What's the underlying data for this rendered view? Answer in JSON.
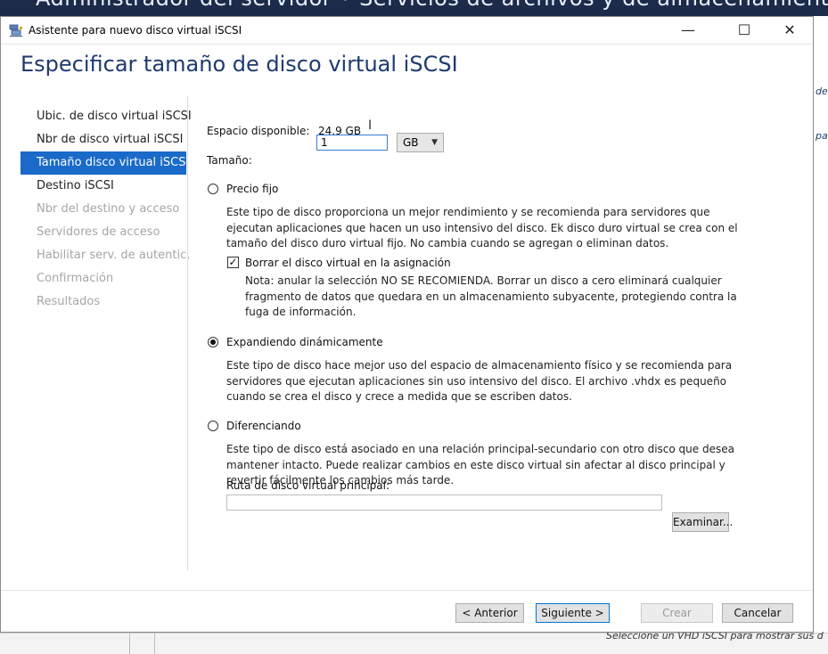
{
  "background": {
    "top_text": "Administrador del servidor • Servicios de archivos y de almacenamiento • iSCSI",
    "right_frag_1": "de",
    "right_frag_2": "par",
    "bottom_frag": "Seleccione un VHD iSCSI para mostrar sus d"
  },
  "window": {
    "title": "Asistente para nuevo disco virtual iSCSI",
    "minimize": "—",
    "maximize": "☐",
    "close": "✕"
  },
  "page_title": "Especificar tamaño de disco virtual iSCSI",
  "nav": {
    "items": [
      {
        "label": "Ubic. de disco virtual iSCSI",
        "state": "normal"
      },
      {
        "label": "Nbr de disco virtual iSCSI",
        "state": "normal"
      },
      {
        "label": "Tamaño disco virtual iSCSI",
        "state": "selected"
      },
      {
        "label": "Destino iSCSI",
        "state": "normal"
      },
      {
        "label": "Nbr del destino y acceso",
        "state": "disabled"
      },
      {
        "label": "Servidores de acceso",
        "state": "disabled"
      },
      {
        "label": "Habilitar serv. de autentic.",
        "state": "disabled"
      },
      {
        "label": "Confirmación",
        "state": "disabled"
      },
      {
        "label": "Resultados",
        "state": "disabled"
      }
    ]
  },
  "space": {
    "label": "Espacio disponible:",
    "value": "24,9 GB"
  },
  "size": {
    "label": "Tamaño:",
    "value": "1",
    "unit": "GB"
  },
  "options": {
    "fixed": {
      "label": "Precio fijo",
      "selected": false,
      "desc_lines": [
        "Este tipo de disco proporciona un mejor rendimiento y se recomienda para servidores que",
        "ejecutan aplicaciones que hacen un uso intensivo del disco. Ek disco duro virtual se crea con el",
        "tamaño del disco duro virtual fijo. No cambia cuando se agregan o eliminan datos."
      ],
      "checkbox_label": "Borrar el disco virtual en la asignación",
      "checkbox_checked": true,
      "note_lines": [
        "Nota: anular la selección NO SE RECOMIENDA. Borrar un disco a cero eliminará cualquier",
        "fragmento de datos que quedara en un almacenamiento subyacente, protegiendo contra la",
        "fuga de información."
      ]
    },
    "dynamic": {
      "label": "Expandiendo dinámicamente",
      "selected": true,
      "desc_lines": [
        "Este tipo de disco hace mejor uso del espacio de almacenamiento físico y se recomienda para",
        "servidores que ejecutan aplicaciones sin uso intensivo del disco. El archivo .vhdx es pequeño",
        "cuando se crea el disco y crece a medida que se escriben datos."
      ]
    },
    "differencing": {
      "label": "Diferenciando",
      "selected": false,
      "desc_lines": [
        "Este tipo de disco está asociado en una relación principal-secundario con otro disco que desea",
        "mantener intacto. Puede realizar cambios en este disco virtual sin afectar al disco principal y",
        "revertir fácilmente los cambios más tarde."
      ],
      "path_label": "Ruta de disco virtual principal:",
      "path_value": "",
      "browse_label": "Examinar..."
    }
  },
  "buttons": {
    "previous": "< Anterior",
    "next": "Siguiente >",
    "create": "Crear",
    "cancel": "Cancelar"
  },
  "colors": {
    "accent": "#1a6ac9",
    "title": "#1e3a6e",
    "disabled_text": "#a6a6a6"
  }
}
